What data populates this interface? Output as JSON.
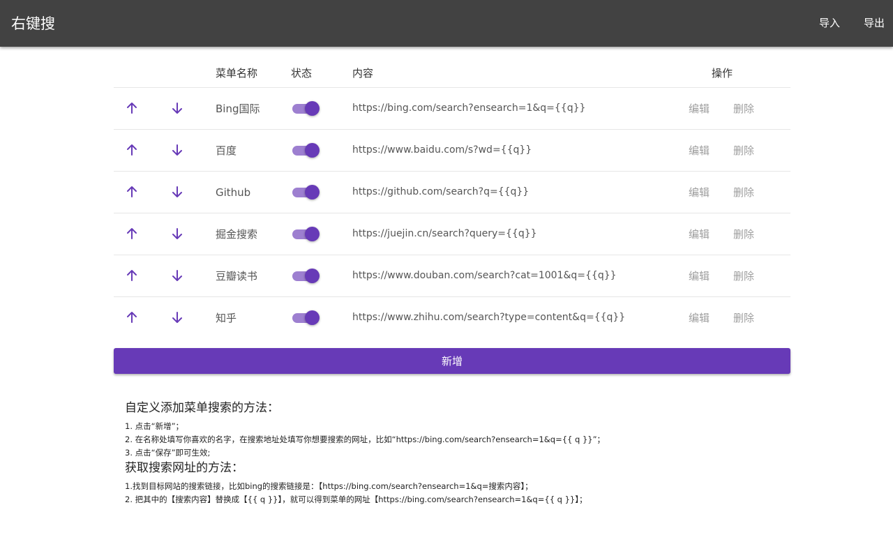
{
  "app": {
    "title": "右键搜",
    "import_label": "导入",
    "export_label": "导出"
  },
  "table": {
    "headers": {
      "name": "菜单名称",
      "status": "状态",
      "content": "内容",
      "actions": "操作"
    },
    "rows": [
      {
        "name": "Bing国际",
        "url": "https://bing.com/search?ensearch=1&q={{q}}",
        "enabled": true
      },
      {
        "name": "百度",
        "url": "https://www.baidu.com/s?wd={{q}}",
        "enabled": true
      },
      {
        "name": "Github",
        "url": "https://github.com/search?q={{q}}",
        "enabled": true
      },
      {
        "name": "掘金搜索",
        "url": "https://juejin.cn/search?query={{q}}",
        "enabled": true
      },
      {
        "name": "豆瓣读书",
        "url": "https://www.douban.com/search?cat=1001&q={{q}}",
        "enabled": true
      },
      {
        "name": "知乎",
        "url": "https://www.zhihu.com/search?type=content&q={{q}}",
        "enabled": true
      }
    ],
    "edit_label": "编辑",
    "delete_label": "删除",
    "up_icon": "arrow-up-icon",
    "down_icon": "arrow-down-icon"
  },
  "add_button": {
    "label": "新增"
  },
  "help": {
    "add_title": "自定义添加菜单搜索的方法：",
    "add_steps": [
      "1. 点击“新增”；",
      "2. 在名称处填写你喜欢的名字，在搜索地址处填写你想要搜索的网址，比如“https://bing.com/search?ensearch=1&q={{ q }}”；",
      "3. 点击“保存”即可生效;"
    ],
    "url_title": "获取搜索网址的方法：",
    "url_steps": [
      "1.找到目标网站的搜索链接，比如bing的搜索链接是：【https://bing.com/search?ensearch=1&q=搜索内容】；",
      "2. 把其中的【搜索内容】替换成【{{ q }}】，就可以得到菜单的网址【https://bing.com/search?ensearch=1&q={{ q }}】；"
    ]
  },
  "colors": {
    "accent": "#673ab7",
    "toggle_track": "#9d7fd0",
    "topbar": "#424242",
    "action_text": "#9e9e9e"
  }
}
